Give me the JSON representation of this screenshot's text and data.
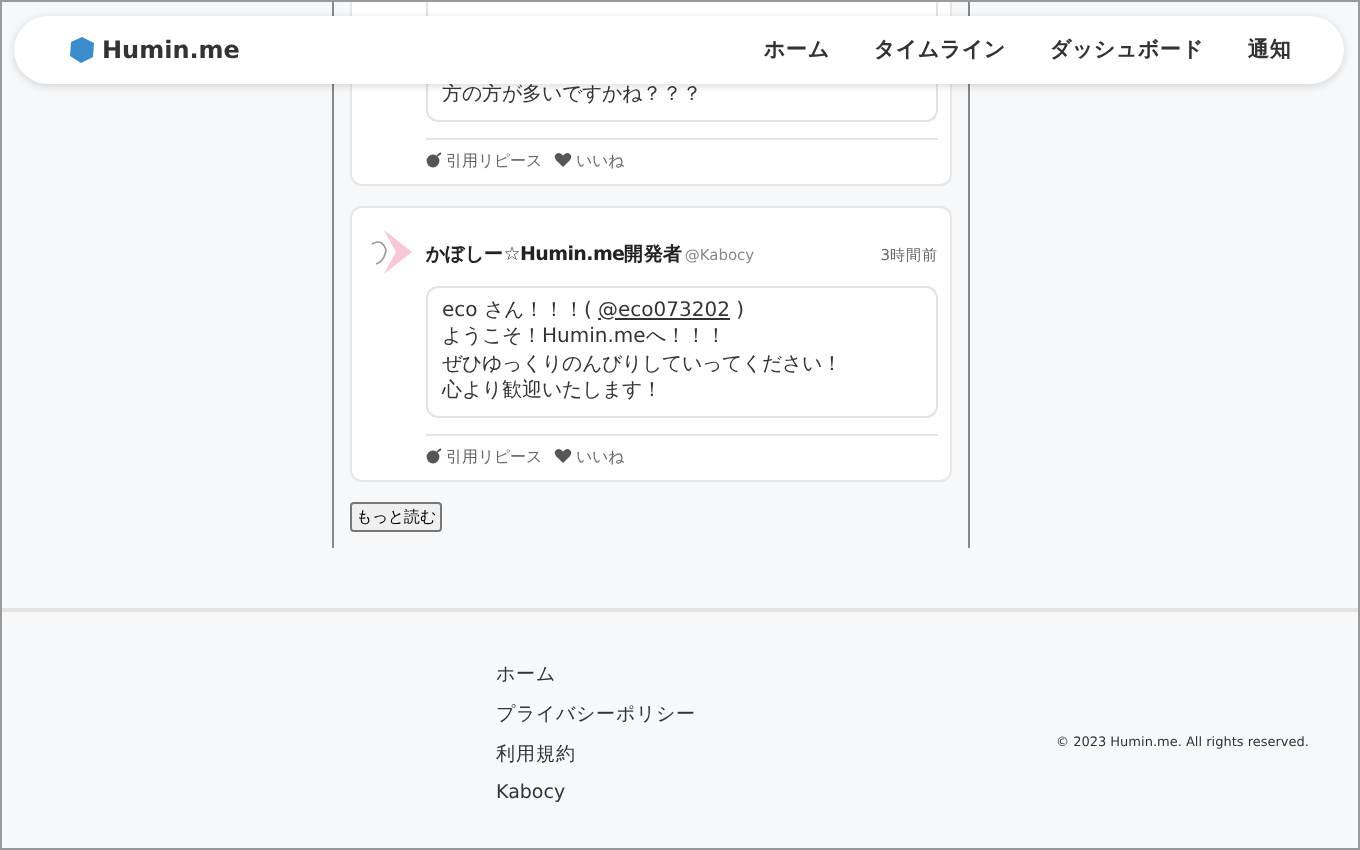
{
  "header": {
    "logo": "Humin.me",
    "nav": [
      "ホーム",
      "タイムライン",
      "ダッシュボード",
      "通知"
    ]
  },
  "posts": [
    {
      "body": [
        [
          {
            "kind": "text",
            "text": "方の方が多いですかね？？？"
          }
        ]
      ],
      "actions": [
        "引用リピース",
        "いいね"
      ]
    },
    {
      "author": "かぼしー☆Humin.me開発者",
      "handle": "@Kabocy",
      "time": "3時間前",
      "body": [
        [
          {
            "kind": "text",
            "text": "eco さん！！！( "
          },
          {
            "kind": "mention",
            "text": "@eco073202"
          },
          {
            "kind": "text",
            "text": " )"
          }
        ],
        [
          {
            "kind": "text",
            "text": "ようこそ！Humin.meへ！！！"
          }
        ],
        [
          {
            "kind": "text",
            "text": "ぜひゆっくりのんびりしていってください！"
          }
        ],
        [
          {
            "kind": "text",
            "text": "心より歓迎いたします！"
          }
        ]
      ],
      "actions": [
        "引用リピース",
        "いいね"
      ]
    }
  ],
  "more_button": "もっと読む",
  "footer": {
    "links": [
      "ホーム",
      "プライバシーポリシー",
      "利用規約",
      "Kabocy"
    ],
    "copyright": "© 2023 Humin.me. All rights reserved."
  }
}
